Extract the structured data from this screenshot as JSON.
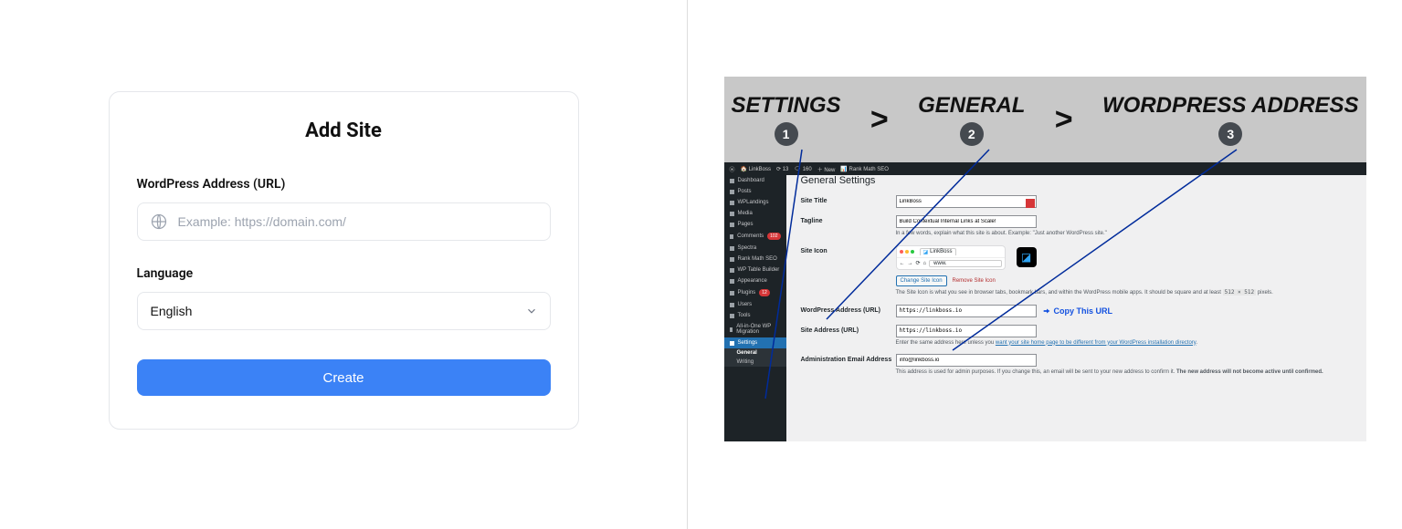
{
  "left": {
    "title": "Add Site",
    "wp_label": "WordPress Address (URL)",
    "wp_placeholder": "Example: https://domain.com/",
    "lang_label": "Language",
    "lang_value": "English",
    "create_btn": "Create"
  },
  "right": {
    "banner": {
      "step1": "SETTINGS",
      "step2": "GENERAL",
      "step3": "WORDPRESS ADDRESS",
      "badge1": "1",
      "badge2": "2",
      "badge3": "3"
    },
    "adminbar": {
      "site": "LinkBoss",
      "updates": "13",
      "comments": "160",
      "new": "New",
      "rankmath": "Rank Math SEO"
    },
    "sidebar": {
      "items": [
        "Dashboard",
        "Posts",
        "WPLandings",
        "Media",
        "Pages",
        "Comments",
        "Spectra",
        "Rank Math SEO",
        "WP Table Builder",
        "Appearance",
        "Plugins",
        "Users",
        "Tools",
        "All-in-One WP Migration",
        "Settings"
      ],
      "comments_badge": "102",
      "plugins_badge": "12",
      "sub": [
        "General",
        "Writing"
      ]
    },
    "page": {
      "heading": "General Settings",
      "rows": {
        "site_title_label": "Site Title",
        "site_title_value": "LinkBoss",
        "tagline_label": "Tagline",
        "tagline_value": "Build Contextual Internal Links at Scale!",
        "tagline_desc": "In a few words, explain what this site is about. Example: \"Just another WordPress site.\"",
        "site_icon_label": "Site Icon",
        "browser_tab": "LinkBoss",
        "browser_url": "www.",
        "change_icon": "Change Site Icon",
        "remove_icon": "Remove Site Icon",
        "site_icon_desc_a": "The Site Icon is what you see in browser tabs, bookmark bars, and within the WordPress mobile apps. It should be square and at least",
        "site_icon_desc_b": "512 × 512",
        "site_icon_desc_c": "pixels.",
        "wp_addr_label": "WordPress Address (URL)",
        "wp_addr_value": "https://linkboss.io",
        "copy_call": "Copy This URL",
        "site_addr_label": "Site Address (URL)",
        "site_addr_value": "https://linkboss.io",
        "site_addr_desc_a": "Enter the same address here unless you",
        "site_addr_link": "want your site home page to be different from your WordPress installation directory",
        "admin_email_label": "Administration Email Address",
        "admin_email_value": "info@linkboss.io",
        "admin_email_desc_a": "This address is used for admin purposes. If you change this, an email will be sent to your new address to confirm it.",
        "admin_email_desc_b": "The new address will not become active until confirmed."
      }
    }
  }
}
